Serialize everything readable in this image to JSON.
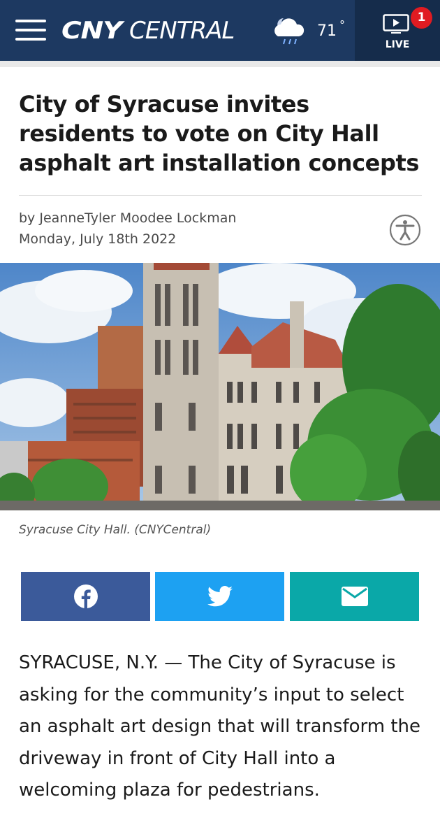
{
  "header": {
    "logo_part1": "CNY",
    "logo_part2": "CENTRAL",
    "temperature": "71",
    "temperature_unit": "°",
    "live_label": "LIVE",
    "live_badge_count": "1"
  },
  "article": {
    "headline": "City of Syracuse invites residents to vote on City Hall asphalt art installation concepts",
    "byline": "by JeanneTyler Moodee Lockman",
    "date": "Monday, July 18th 2022",
    "image_caption": "Syracuse City Hall. (CNYCentral)",
    "body": "SYRACUSE, N.Y. — The City of Syracuse is asking for the community’s input to select an asphalt art design that will transform the driveway in front of City Hall into a welcoming plaza for pedestrians."
  },
  "share": {
    "buttons": [
      {
        "icon": "facebook-icon",
        "color": "#3b5a9a"
      },
      {
        "icon": "twitter-icon",
        "color": "#1da1f2"
      },
      {
        "icon": "email-icon",
        "color": "#0aa8a8"
      }
    ]
  },
  "colors": {
    "header_bg": "#1d3961",
    "live_bg": "#152c4b",
    "badge": "#e01b22"
  }
}
